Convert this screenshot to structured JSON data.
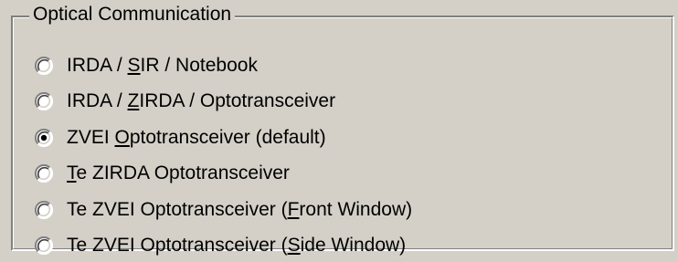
{
  "group": {
    "title": "Optical Communication"
  },
  "options": [
    {
      "label_before": "IRDA / ",
      "mnemonic": "S",
      "label_after": "IR / Notebook",
      "selected": false
    },
    {
      "label_before": "IRDA / ",
      "mnemonic": "Z",
      "label_after": "IRDA / Optotransceiver",
      "selected": false
    },
    {
      "label_before": "ZVEI ",
      "mnemonic": "O",
      "label_after": "ptotransceiver (default)",
      "selected": true
    },
    {
      "label_before": "",
      "mnemonic": "T",
      "label_after": "e ZIRDA Optotransceiver",
      "selected": false
    },
    {
      "label_before": "Te ZVEI Optotransceiver (",
      "mnemonic": "F",
      "label_after": "ront Window)",
      "selected": false
    },
    {
      "label_before": "Te ZVEI Optotransceiver (",
      "mnemonic": "S",
      "label_after": "ide Window)",
      "selected": false
    }
  ],
  "colors": {
    "face": "#d4d0c8",
    "shadow": "#808080",
    "dark_shadow": "#404040",
    "highlight": "#ffffff",
    "dot": "#000000"
  }
}
